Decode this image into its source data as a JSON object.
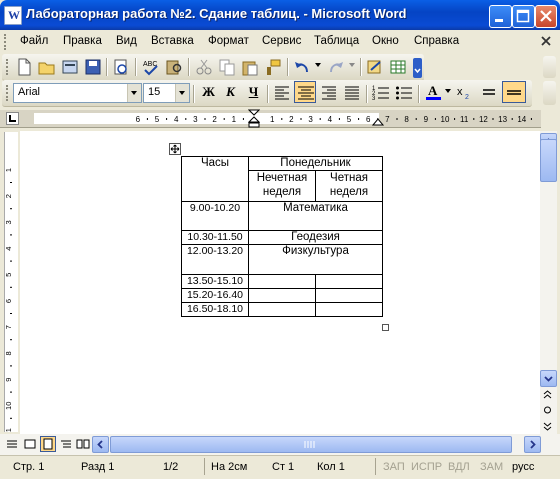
{
  "window": {
    "title": "Лабораторная работа №2. Сдание таблиц. - Microsoft Word",
    "app_icon_letter": "W"
  },
  "menu": [
    {
      "label": "Файл"
    },
    {
      "label": "Правка"
    },
    {
      "label": "Вид"
    },
    {
      "label": "Вставка"
    },
    {
      "label": "Формат"
    },
    {
      "label": "Сервис"
    },
    {
      "label": "Таблица"
    },
    {
      "label": "Окно"
    },
    {
      "label": "Справка"
    }
  ],
  "formatting": {
    "font": "Arial",
    "size": "15",
    "bold": "Ж",
    "italic": "К",
    "underline": "Ч",
    "active_alignment": "center"
  },
  "ruler": {
    "h_numbers": [
      "6",
      "5",
      "4",
      "3",
      "2",
      "1",
      "1",
      "2",
      "3",
      "4",
      "5",
      "6",
      "7",
      "8",
      "9",
      "10",
      "11",
      "12",
      "13",
      "14"
    ],
    "v_numbers": [
      "1",
      "2",
      "3",
      "4",
      "5",
      "6",
      "7",
      "8",
      "9",
      "10",
      "11"
    ]
  },
  "table": {
    "header": {
      "time": "Часы",
      "day": "Понедельник",
      "odd": "Нечетная неделя",
      "even": "Четная неделя"
    },
    "rows": [
      {
        "time": "9.00-10.20",
        "subject": "Математика"
      },
      {
        "time": "10.30-11.50",
        "subject": "Геодезия"
      },
      {
        "time": "12.00-13.20",
        "subject": "Физкультура"
      },
      {
        "time": "13.50-15.10",
        "subject": ""
      },
      {
        "time": "15.20-16.40",
        "subject": ""
      },
      {
        "time": "16.50-18.10",
        "subject": ""
      }
    ]
  },
  "status": {
    "page": "Стр. 1",
    "section": "Разд 1",
    "pages": "1/2",
    "at": "На 2см",
    "line": "Ст 1",
    "col": "Кол 1",
    "rec": "ЗАП",
    "trk": "ИСПР",
    "ext": "ВДЛ",
    "ovr": "ЗАМ",
    "lang": "русс"
  },
  "colors": {
    "titlebar": "#0a5fe6",
    "highlight": "#ffd88a",
    "font_color": "#0000ff"
  }
}
